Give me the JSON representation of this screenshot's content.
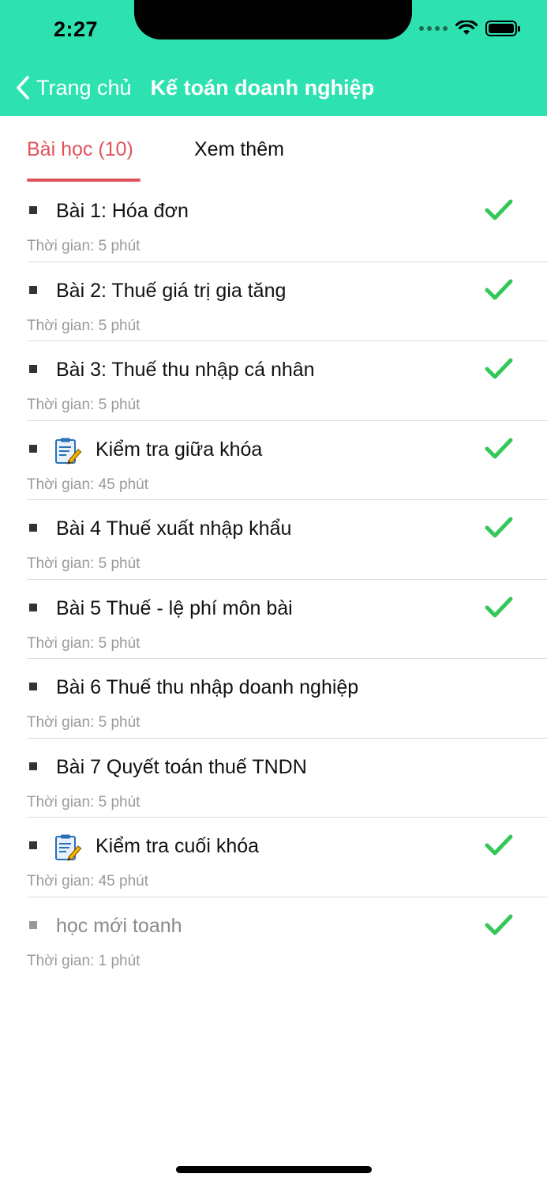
{
  "status_bar": {
    "time": "2:27"
  },
  "nav": {
    "back_label": "Trang chủ",
    "title": "Kế toán doanh nghiệp"
  },
  "tabs": [
    {
      "label": "Bài học (10)",
      "active": true
    },
    {
      "label": "Xem thêm",
      "active": false
    }
  ],
  "colors": {
    "header": "#2de2b0",
    "active_tab": "#e0525a",
    "check": "#34c759"
  },
  "lessons": [
    {
      "title": "Bài 1: Hóa đơn",
      "time": "Thời gian: 5 phút",
      "completed": true,
      "icon": ""
    },
    {
      "title": "Bài 2: Thuế giá trị gia tăng",
      "time": "Thời gian: 5 phút",
      "completed": true,
      "icon": ""
    },
    {
      "title": "Bài 3: Thuế thu nhập cá nhân",
      "time": "Thời gian: 5 phút",
      "completed": true,
      "icon": ""
    },
    {
      "title": "Kiểm tra giữa khóa",
      "time": "Thời gian: 45 phút",
      "completed": true,
      "icon": "quiz-document-icon"
    },
    {
      "title": "Bài 4 Thuế xuất nhập khẩu",
      "time": "Thời gian: 5 phút",
      "completed": true,
      "icon": ""
    },
    {
      "title": "Bài 5 Thuế - lệ phí môn bài",
      "time": "Thời gian: 5 phút",
      "completed": true,
      "icon": ""
    },
    {
      "title": "Bài 6 Thuế thu nhập doanh nghiệp",
      "time": "Thời gian: 5 phút",
      "completed": false,
      "icon": ""
    },
    {
      "title": "Bài 7 Quyết toán thuế TNDN",
      "time": "Thời gian: 5 phút",
      "completed": false,
      "icon": ""
    },
    {
      "title": "Kiểm tra cuối khóa",
      "time": "Thời gian: 45 phút",
      "completed": true,
      "icon": "quiz-document-icon"
    },
    {
      "title": "học mới toanh",
      "time": "Thời gian: 1 phút",
      "completed": true,
      "icon": "",
      "muted": true
    }
  ]
}
